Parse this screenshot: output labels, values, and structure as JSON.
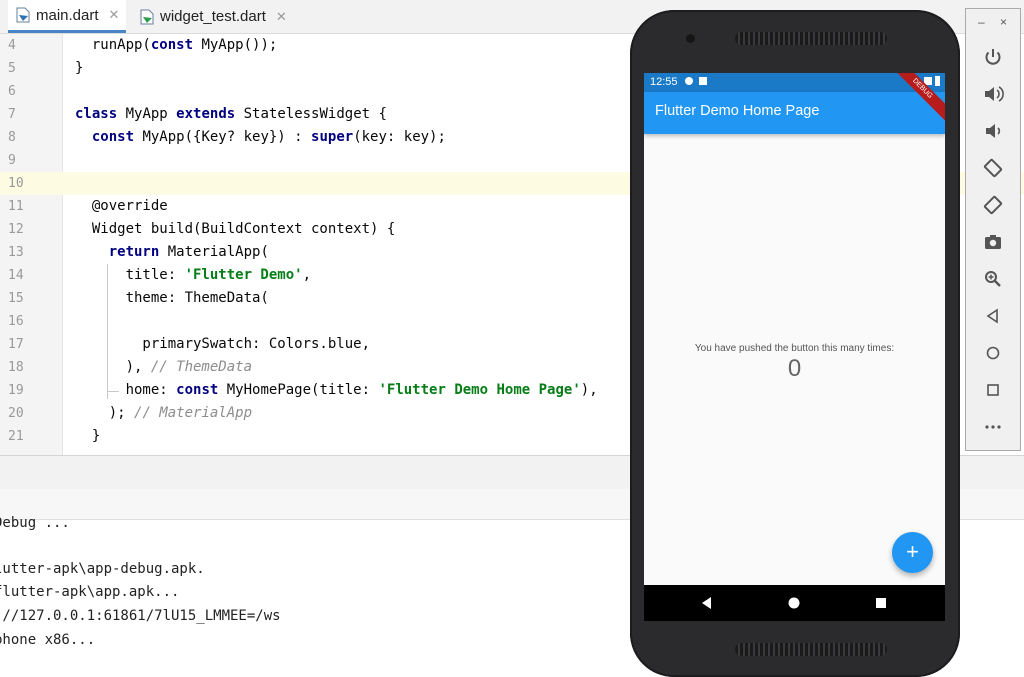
{
  "tabs": [
    {
      "label": "main.dart",
      "active": true,
      "icon": "dart-file-icon",
      "close": "✕"
    },
    {
      "label": "widget_test.dart",
      "active": false,
      "icon": "dart-file-icon",
      "close": "✕"
    }
  ],
  "editor": {
    "current_line": "10",
    "lines": [
      {
        "num": "4"
      },
      {
        "num": "5"
      },
      {
        "num": "6"
      },
      {
        "num": "7"
      },
      {
        "num": "8"
      },
      {
        "num": "9"
      },
      {
        "num": "10"
      },
      {
        "num": "11"
      },
      {
        "num": "12"
      },
      {
        "num": "13"
      },
      {
        "num": "14"
      },
      {
        "num": "15"
      },
      {
        "num": "16"
      },
      {
        "num": "17"
      },
      {
        "num": "18"
      },
      {
        "num": "19"
      },
      {
        "num": "20"
      },
      {
        "num": "21"
      }
    ],
    "code": {
      "l4_a": "  runApp(",
      "l4_kw": "const",
      "l4_b": " MyApp());",
      "l5": "}",
      "l7_kw1": "class",
      "l7_a": " MyApp ",
      "l7_kw2": "extends",
      "l7_b": " StatelessWidget {",
      "l8_a": "  ",
      "l8_kw1": "const",
      "l8_b": " MyApp({Key? key}) : ",
      "l8_kw2": "super",
      "l8_c": "(key: key);",
      "l11": "  @override",
      "l12": "  Widget build(BuildContext context) {",
      "l13_a": "    ",
      "l13_kw": "return",
      "l13_b": " MaterialApp(",
      "l14_a": "      title: ",
      "l14_str": "'Flutter Demo'",
      "l14_b": ",",
      "l15": "      theme: ThemeData(",
      "l17": "        primarySwatch: Colors.blue,",
      "l18_a": "      ), ",
      "l18_cm": "// ThemeData",
      "l19_a": "      home: ",
      "l19_kw": "const",
      "l19_b": " MyHomePage(title: ",
      "l19_str": "'Flutter Demo Home Page'",
      "l19_c": "),",
      "l20_a": "    ); ",
      "l20_cm": "// MaterialApp",
      "l21": "  }"
    }
  },
  "console": {
    "lines": [
      "Debug ...",
      "",
      "lutter-apk\\app-debug.apk.",
      "flutter-apk\\app.apk...",
      " //127.0.0.1:61861/7lU15_LMMEE=/ws",
      "phone x86..."
    ]
  },
  "phone": {
    "status_time": "12:55",
    "app_title": "Flutter Demo Home Page",
    "debug_banner": "DEBUG",
    "counter_label": "You have pushed the button this many times:",
    "counter_value": "0",
    "fab_label": "+",
    "fab_icon": "add-icon",
    "nav_buttons": [
      "back-icon",
      "home-icon",
      "recents-icon"
    ]
  },
  "emulator_toolbar": {
    "minimize": "–",
    "close": "×",
    "buttons": [
      "power-icon",
      "volume-up-icon",
      "volume-down-icon",
      "rotate-left-icon",
      "rotate-right-icon",
      "camera-icon",
      "zoom-icon",
      "back-icon",
      "home-icon",
      "overview-icon",
      "more-icon"
    ]
  },
  "colors": {
    "app_bar": "#2196f3",
    "status_bar": "#1a7ac7",
    "keyword": "#000080",
    "string": "#067d17",
    "comment": "#8c8c8c",
    "current_line_bg": "#fefbe3"
  }
}
